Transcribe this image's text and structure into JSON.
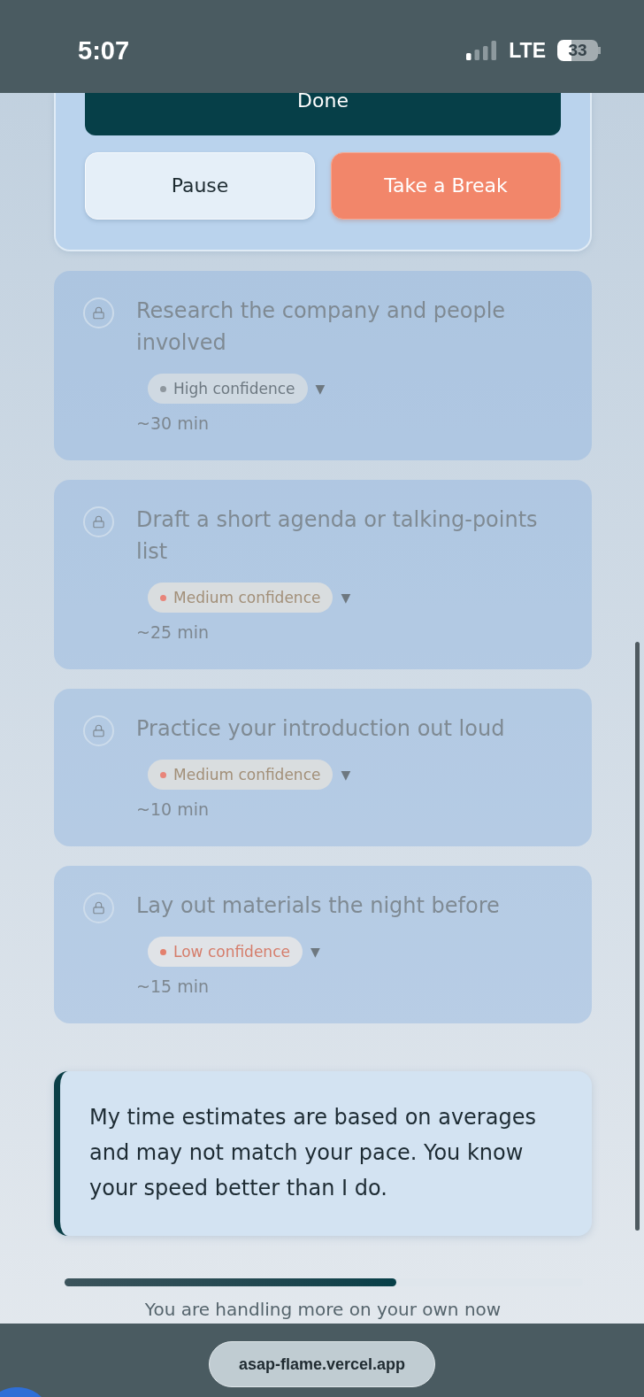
{
  "status_bar": {
    "time": "5:07",
    "network": "LTE",
    "battery": "33"
  },
  "session_card": {
    "primary_button": {
      "label": "Done"
    },
    "buttons": [
      {
        "label": "Pause",
        "kind": "neutral"
      },
      {
        "label": "Take a Break",
        "kind": "accent"
      }
    ]
  },
  "tasks": [
    {
      "title": "Research the company and people involved",
      "locked": true,
      "confidence": {
        "label": "High confidence",
        "kind": "high",
        "color": "#8e979e"
      },
      "toggle": "▼",
      "estimate": "~30 min"
    },
    {
      "title": "Draft a short agenda or talking-points list",
      "locked": true,
      "confidence": {
        "label": "Medium confidence",
        "kind": "medium",
        "color": "#e8857a"
      },
      "toggle": "▼",
      "estimate": "~25 min"
    },
    {
      "title": "Practice your introduction out loud",
      "locked": true,
      "confidence": {
        "label": "Medium confidence",
        "kind": "medium",
        "color": "#e8857a"
      },
      "toggle": "▼",
      "estimate": "~10 min"
    },
    {
      "title": "Lay out materials the night before",
      "locked": true,
      "confidence": {
        "label": "Low confidence",
        "kind": "low",
        "color": "#e3806d"
      },
      "toggle": "▼",
      "estimate": "~15 min"
    }
  ],
  "note": "My time estimates are based on averages and may not match your pace. You know your speed better than I do.",
  "progress": {
    "level": 0.64
  },
  "status_message": "You are handling more on your own now",
  "browser_bar": {
    "url": "asap-flame.vercel.app"
  }
}
